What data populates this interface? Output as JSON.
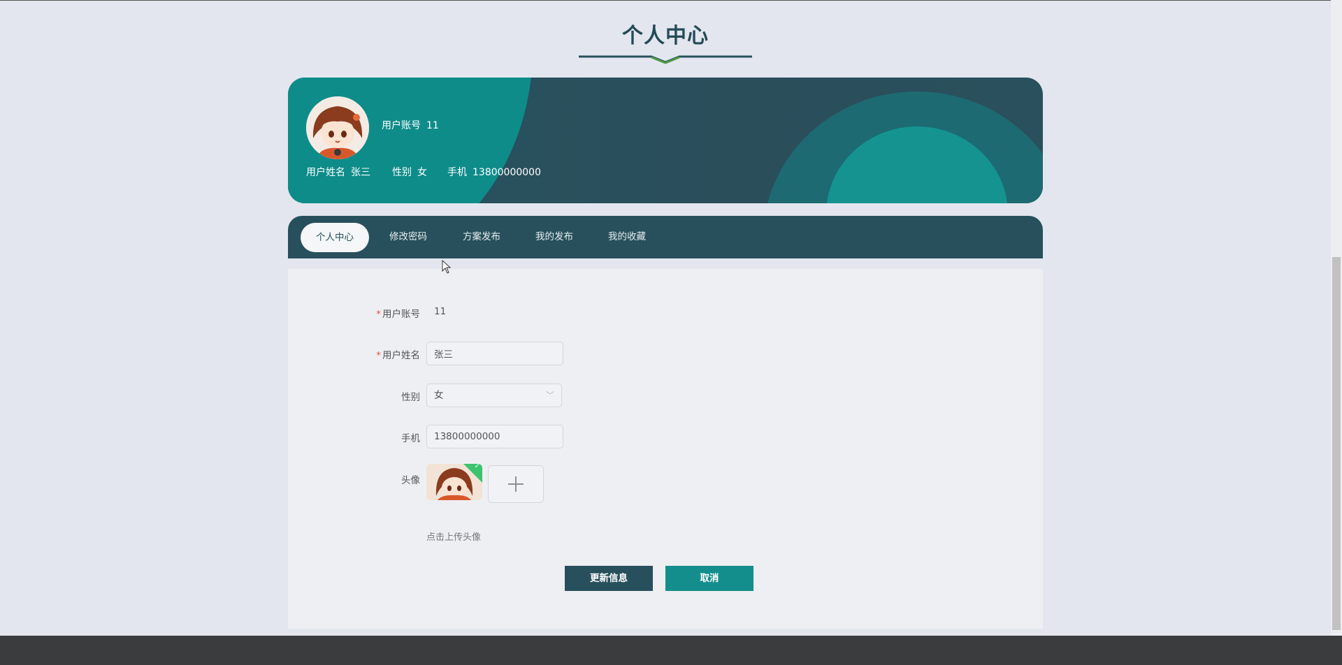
{
  "page": {
    "title": "个人中心"
  },
  "profile": {
    "account_label": "用户账号",
    "account_value": "11",
    "name_label": "用户姓名",
    "name_value": "张三",
    "gender_label": "性别",
    "gender_value": "女",
    "phone_label": "手机",
    "phone_value": "13800000000"
  },
  "tabs": [
    {
      "label": "个人中心",
      "active": true
    },
    {
      "label": "修改密码",
      "active": false
    },
    {
      "label": "方案发布",
      "active": false
    },
    {
      "label": "我的发布",
      "active": false
    },
    {
      "label": "我的收藏",
      "active": false
    }
  ],
  "form": {
    "account": {
      "label": "用户账号",
      "value": "11",
      "required": true
    },
    "name": {
      "label": "用户姓名",
      "value": "张三",
      "required": true
    },
    "gender": {
      "label": "性别",
      "value": "女"
    },
    "phone": {
      "label": "手机",
      "value": "13800000000"
    },
    "avatar": {
      "label": "头像",
      "hint": "点击上传头像"
    }
  },
  "buttons": {
    "update": "更新信息",
    "cancel": "取消"
  },
  "colors": {
    "primary": "#27505c",
    "accent": "#138e8c",
    "required": "#e5534b"
  },
  "icons": {
    "add": "plus-icon",
    "select_arrow": "chevron-down-icon",
    "uploaded": "check-icon"
  }
}
